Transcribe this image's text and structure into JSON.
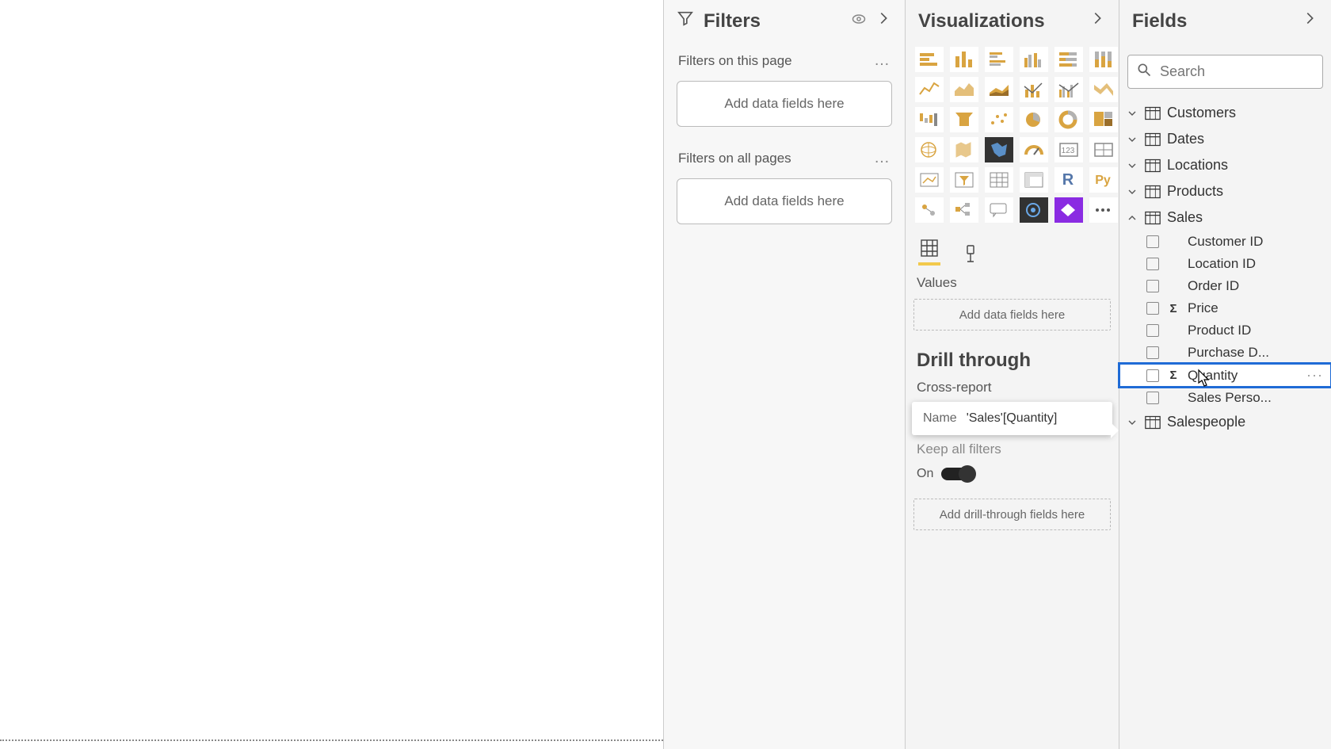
{
  "filters": {
    "title": "Filters",
    "page_section": "Filters on this page",
    "all_section": "Filters on all pages",
    "drop_text": "Add data fields here"
  },
  "viz": {
    "title": "Visualizations",
    "values_label": "Values",
    "values_drop": "Add data fields here",
    "drill_header": "Drill through",
    "cross_report": "Cross-report",
    "tooltip_label": "Name",
    "tooltip_value": "'Sales'[Quantity]",
    "keep_all": "Keep all filters",
    "keep_on": "On",
    "drill_drop": "Add drill-through fields here",
    "r_label": "R",
    "py_label": "Py"
  },
  "fields": {
    "title": "Fields",
    "search_placeholder": "Search",
    "tables": [
      {
        "name": "Customers",
        "expanded": false
      },
      {
        "name": "Dates",
        "expanded": false
      },
      {
        "name": "Locations",
        "expanded": false
      },
      {
        "name": "Products",
        "expanded": false
      },
      {
        "name": "Sales",
        "expanded": true
      },
      {
        "name": "Salespeople",
        "expanded": false
      }
    ],
    "sales_fields": [
      {
        "label": "Customer ID",
        "sigma": false
      },
      {
        "label": "Location ID",
        "sigma": false
      },
      {
        "label": "Order ID",
        "sigma": false
      },
      {
        "label": "Price",
        "sigma": true
      },
      {
        "label": "Product ID",
        "sigma": false
      },
      {
        "label": "Purchase D...",
        "sigma": false
      },
      {
        "label": "Quantity",
        "sigma": true,
        "highlight": true
      },
      {
        "label": "Sales Perso...",
        "sigma": false,
        "dim": true
      }
    ]
  }
}
